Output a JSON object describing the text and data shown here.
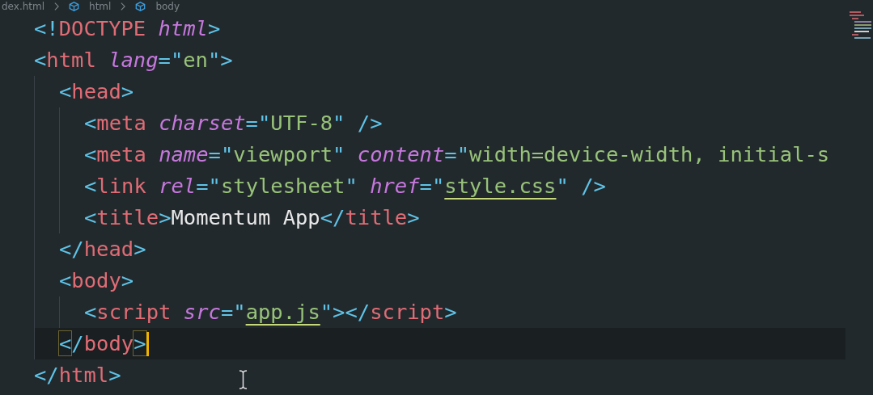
{
  "breadcrumb": [
    {
      "label": "dex.html",
      "kind": "file"
    },
    {
      "label": "html",
      "kind": "element"
    },
    {
      "label": "body",
      "kind": "element"
    }
  ],
  "lines": [
    {
      "tokens": [
        {
          "kind": "punct",
          "text": "<!"
        },
        {
          "kind": "tag",
          "text": "DOCTYPE"
        },
        {
          "kind": "attr",
          "text": " html"
        },
        {
          "kind": "punct",
          "text": ">"
        }
      ]
    },
    {
      "tokens": [
        {
          "kind": "punct",
          "text": "<"
        },
        {
          "kind": "tag",
          "text": "html"
        },
        {
          "kind": "attr",
          "text": " lang"
        },
        {
          "kind": "punct",
          "text": "=\""
        },
        {
          "kind": "string",
          "text": "en"
        },
        {
          "kind": "punct",
          "text": "\">"
        }
      ],
      "children": [
        {
          "tokens": [
            {
              "kind": "punct",
              "text": "<"
            },
            {
              "kind": "tag",
              "text": "head"
            },
            {
              "kind": "punct",
              "text": ">"
            }
          ],
          "children": [
            {
              "tokens": [
                {
                  "kind": "punct",
                  "text": "<"
                },
                {
                  "kind": "tag",
                  "text": "meta"
                },
                {
                  "kind": "attr",
                  "text": " charset"
                },
                {
                  "kind": "punct",
                  "text": "=\""
                },
                {
                  "kind": "string",
                  "text": "UTF-8"
                },
                {
                  "kind": "punct",
                  "text": "\" />"
                }
              ]
            },
            {
              "tokens": [
                {
                  "kind": "punct",
                  "text": "<"
                },
                {
                  "kind": "tag",
                  "text": "meta"
                },
                {
                  "kind": "attr",
                  "text": " name"
                },
                {
                  "kind": "punct",
                  "text": "=\""
                },
                {
                  "kind": "string",
                  "text": "viewport"
                },
                {
                  "kind": "punct",
                  "text": "\""
                },
                {
                  "kind": "attr",
                  "text": " content"
                },
                {
                  "kind": "punct",
                  "text": "=\""
                },
                {
                  "kind": "string",
                  "text": "width=device-width, initial-s"
                }
              ]
            },
            {
              "tokens": [
                {
                  "kind": "punct",
                  "text": "<"
                },
                {
                  "kind": "tag",
                  "text": "link"
                },
                {
                  "kind": "attr",
                  "text": " rel"
                },
                {
                  "kind": "punct",
                  "text": "=\""
                },
                {
                  "kind": "string",
                  "text": "stylesheet"
                },
                {
                  "kind": "punct",
                  "text": "\""
                },
                {
                  "kind": "attr",
                  "text": " href"
                },
                {
                  "kind": "punct",
                  "text": "=\""
                },
                {
                  "kind": "link",
                  "text": "style.css"
                },
                {
                  "kind": "punct",
                  "text": "\" />"
                }
              ]
            },
            {
              "tokens": [
                {
                  "kind": "punct",
                  "text": "<"
                },
                {
                  "kind": "tag",
                  "text": "title"
                },
                {
                  "kind": "punct",
                  "text": ">"
                },
                {
                  "kind": "text",
                  "text": "Momentum App"
                },
                {
                  "kind": "punct",
                  "text": "</"
                },
                {
                  "kind": "tag",
                  "text": "title"
                },
                {
                  "kind": "punct",
                  "text": ">"
                }
              ]
            }
          ]
        },
        {
          "tokens": [
            {
              "kind": "punct",
              "text": "</"
            },
            {
              "kind": "tag",
              "text": "head"
            },
            {
              "kind": "punct",
              "text": ">"
            }
          ]
        },
        {
          "tokens": [
            {
              "kind": "punct",
              "text": "<"
            },
            {
              "kind": "tag",
              "text": "body"
            },
            {
              "kind": "punct",
              "text": ">"
            }
          ],
          "children": [
            {
              "tokens": [
                {
                  "kind": "punct",
                  "text": "<"
                },
                {
                  "kind": "tag",
                  "text": "script"
                },
                {
                  "kind": "attr",
                  "text": " src"
                },
                {
                  "kind": "punct",
                  "text": "=\""
                },
                {
                  "kind": "link",
                  "text": "app.js"
                },
                {
                  "kind": "punct",
                  "text": "\"></"
                },
                {
                  "kind": "tag",
                  "text": "script"
                },
                {
                  "kind": "punct",
                  "text": ">"
                }
              ]
            }
          ]
        },
        {
          "tokens": [
            {
              "kind": "punct",
              "text": "</"
            },
            {
              "kind": "tag",
              "text": "body"
            },
            {
              "kind": "punct",
              "text": ">"
            }
          ],
          "current": true
        }
      ]
    },
    {
      "tokens": [
        {
          "kind": "punct",
          "text": "</"
        },
        {
          "kind": "tag",
          "text": "html"
        },
        {
          "kind": "punct",
          "text": ">"
        }
      ]
    }
  ]
}
